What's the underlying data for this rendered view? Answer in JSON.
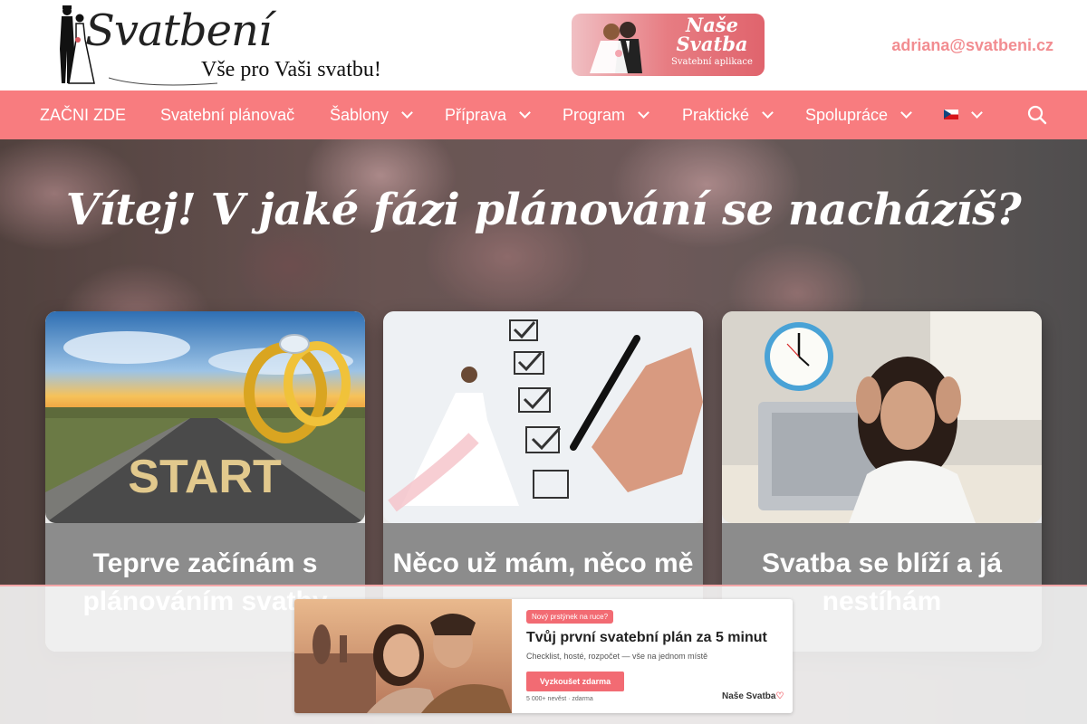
{
  "header": {
    "logo_script": "Svatbení",
    "logo_tagline": "Vše pro Vaši svatbu!",
    "app_banner": {
      "title_line1": "Naše",
      "title_line2": "Svatba",
      "subtitle": "Svatební aplikace"
    },
    "email": "adriana@svatbeni.cz"
  },
  "nav": {
    "items": [
      {
        "label": "ZAČNI ZDE",
        "dropdown": false
      },
      {
        "label": "Svatební plánovač",
        "dropdown": false
      },
      {
        "label": "Šablony",
        "dropdown": true
      },
      {
        "label": "Příprava",
        "dropdown": true
      },
      {
        "label": "Program",
        "dropdown": true
      },
      {
        "label": "Praktické",
        "dropdown": true
      },
      {
        "label": "Spolupráce",
        "dropdown": true
      }
    ],
    "language": "cz-flag-icon",
    "search_icon": "search-icon",
    "color": "#f87c7f"
  },
  "hero": {
    "title": "Vítej! V jaké fázi plánování se nacházíš?",
    "cards": [
      {
        "title": "Teprve začínám s plánováním svatby",
        "image": "start-rings-road-image"
      },
      {
        "title": "Něco už mám, něco mě",
        "image": "bride-checklist-image"
      },
      {
        "title": "Svatba se blíží a já nestíhám",
        "image": "stressed-woman-clock-image"
      }
    ]
  },
  "ad": {
    "badge": "Nový prstýnek na ruce?",
    "headline": "Tvůj první svatební plán za 5 minut",
    "sub": "Checklist, hosté, rozpočet — vše na jednom místě",
    "button": "Vyzkoušet zdarma",
    "footnote": "5 000+ nevěst · zdarma",
    "brand": "Naše Svatba"
  },
  "colors": {
    "accent": "#f87c7f",
    "email": "#f28d91",
    "card_body": "#8c8c8c"
  }
}
